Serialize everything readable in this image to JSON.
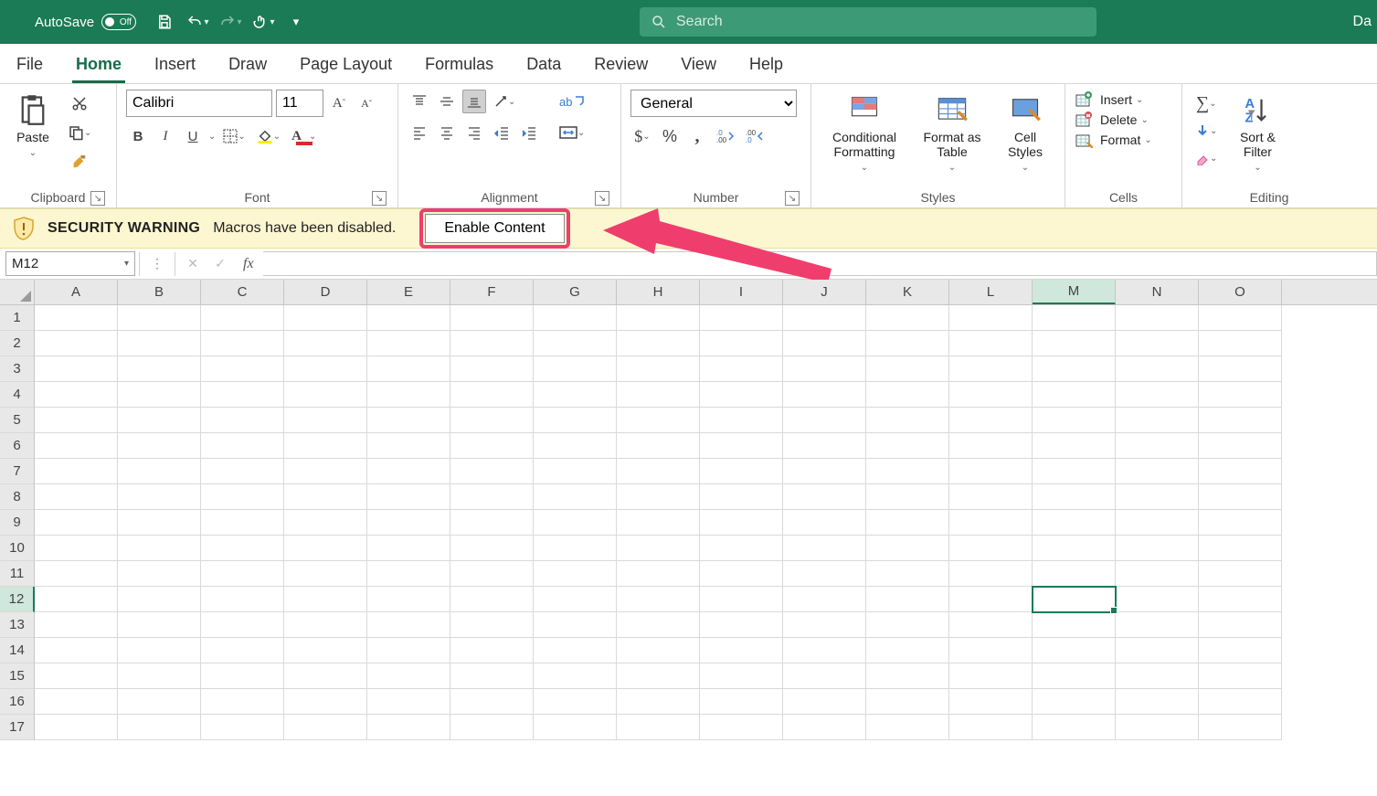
{
  "titlebar": {
    "autosave_label": "AutoSave",
    "autosave_state": "Off",
    "doc_title": "Daily tally",
    "search_placeholder": "Search",
    "right_caption": "Da"
  },
  "tabs": [
    "File",
    "Home",
    "Insert",
    "Draw",
    "Page Layout",
    "Formulas",
    "Data",
    "Review",
    "View",
    "Help"
  ],
  "active_tab": "Home",
  "ribbon": {
    "clipboard": {
      "paste": "Paste",
      "group": "Clipboard"
    },
    "font": {
      "name": "Calibri",
      "size": "11",
      "bold": "B",
      "italic": "I",
      "underline": "U",
      "group": "Font"
    },
    "alignment": {
      "wrap": "ab",
      "group": "Alignment"
    },
    "number": {
      "format": "General",
      "group": "Number"
    },
    "styles": {
      "cond": "Conditional Formatting",
      "table": "Format as Table",
      "cell": "Cell Styles",
      "group": "Styles"
    },
    "cells": {
      "insert": "Insert",
      "delete": "Delete",
      "format": "Format",
      "group": "Cells"
    },
    "editing": {
      "sort": "Sort & Filter",
      "group": "Editing"
    }
  },
  "msgbar": {
    "title": "SECURITY WARNING",
    "text": "Macros have been disabled.",
    "button": "Enable Content"
  },
  "formula": {
    "namebox": "M12",
    "fx": "fx"
  },
  "grid": {
    "cols": [
      "A",
      "B",
      "C",
      "D",
      "E",
      "F",
      "G",
      "H",
      "I",
      "J",
      "K",
      "L",
      "M",
      "N",
      "O"
    ],
    "rows": 17,
    "selected_col": "M",
    "selected_row": 12
  }
}
